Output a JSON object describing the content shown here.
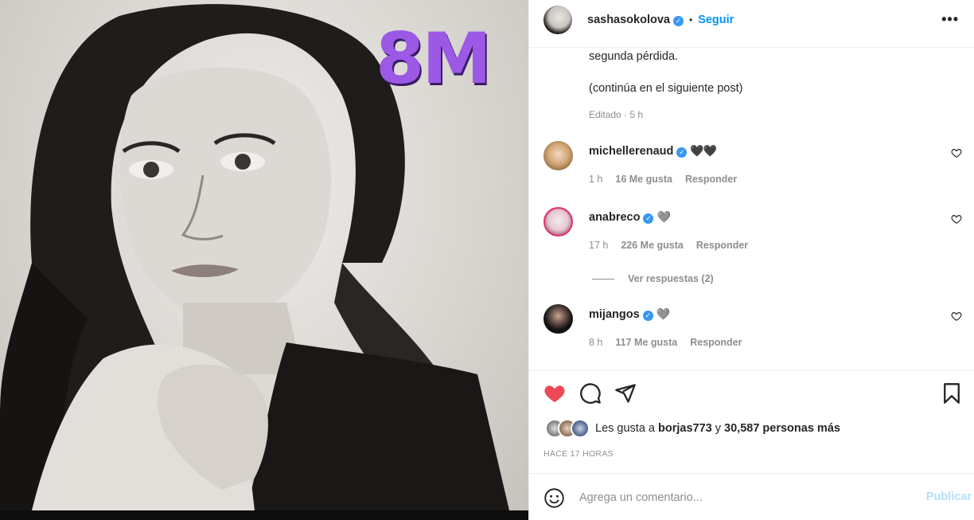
{
  "post": {
    "badge_text": "8M",
    "author": {
      "username": "sashasokolova",
      "verified": true,
      "separator": "•",
      "follow_label": "Seguir",
      "more_label": "•••"
    },
    "caption": {
      "lines": [
        "segunda pérdida.",
        "(continúa en el siguiente post)"
      ],
      "edited_label": "Editado · 5 h"
    },
    "comments": [
      {
        "username": "michellerenaud",
        "verified": true,
        "text": "🖤🖤",
        "time": "1 h",
        "likes": "16 Me gusta",
        "reply_label": "Responder"
      },
      {
        "username": "anabreco",
        "verified": true,
        "text": "🩶",
        "time": "17 h",
        "likes": "226 Me gusta",
        "reply_label": "Responder",
        "view_replies": "Ver respuestas (2)"
      },
      {
        "username": "mijangos",
        "verified": true,
        "text": "🩶",
        "time": "8 h",
        "likes": "117 Me gusta",
        "reply_label": "Responder"
      }
    ],
    "likes_summary": {
      "prefix": "Les gusta a",
      "user": "borjas773",
      "connector": "y",
      "rest": "30,587 personas más"
    },
    "posted_ago": "Hace 17 horas",
    "add_comment": {
      "placeholder": "Agrega un comentario...",
      "publish_label": "Publicar"
    }
  },
  "colors": {
    "accent": "#0095f6",
    "like_red": "#ed4956",
    "muted": "#8e8e8e",
    "badge_purple": "#9b59e6",
    "verified_blue": "#3897f0",
    "publish_disabled": "#b2dffc"
  },
  "icons": [
    "verified-icon",
    "heart-icon",
    "comment-icon",
    "share-icon",
    "bookmark-icon",
    "emoji-icon",
    "more-icon"
  ]
}
